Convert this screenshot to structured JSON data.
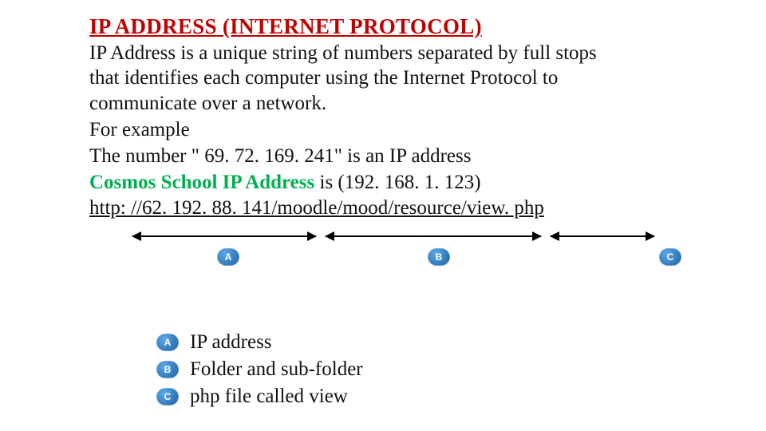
{
  "heading": "IP ADDRESS (INTERNET PROTOCOL)",
  "paragraphs": [
    "IP Address is a unique string of numbers separated by full stops that identifies each computer using the Internet Protocol to communicate over a network.",
    "For example",
    "The number \" 69. 72. 169. 241\" is an IP address"
  ],
  "school_line": {
    "school": "Cosmos School IP Address",
    "rest": " is (192. 168. 1. 123)"
  },
  "url": "http: //62. 192. 88. 141/moodle/mood/resource/view. php",
  "markers": {
    "a": "A",
    "b": "B",
    "c": "C"
  },
  "legend": [
    {
      "marker": "A",
      "text": "IP address"
    },
    {
      "marker": "B",
      "text": "Folder and sub-folder"
    },
    {
      "marker": "C",
      "text": "php file called view"
    }
  ]
}
